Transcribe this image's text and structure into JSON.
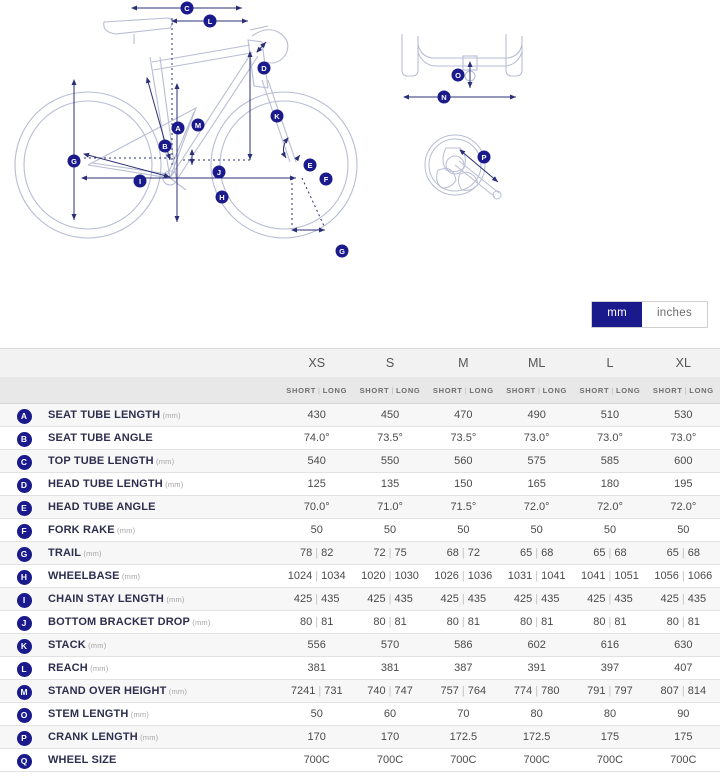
{
  "diagram": {
    "bike_markers": [
      "C",
      "L",
      "D",
      "A",
      "M",
      "B",
      "K",
      "E",
      "F",
      "G",
      "I",
      "H",
      "J",
      "O"
    ],
    "handlebar_markers": [
      "O",
      "N"
    ],
    "crankset_markers": [
      "P"
    ],
    "accent_color": "#1a1a8c",
    "line_color": "#2b2f77",
    "outline_color": "#b8bdd4"
  },
  "units": {
    "mm_label": "mm",
    "inches_label": "inches",
    "selected": "mm"
  },
  "table": {
    "sizes": [
      "XS",
      "S",
      "M",
      "ML",
      "L",
      "XL"
    ],
    "sub_headers": {
      "short": "SHORT",
      "long": "LONG",
      "separator": "|"
    },
    "rows": [
      {
        "badge": "A",
        "label": "SEAT TUBE LENGTH",
        "unit": "(mm)",
        "values": [
          "430",
          "450",
          "470",
          "490",
          "510",
          "530"
        ]
      },
      {
        "badge": "B",
        "label": "SEAT TUBE ANGLE",
        "unit": "",
        "values": [
          "74.0°",
          "73.5°",
          "73.5°",
          "73.0°",
          "73.0°",
          "73.0°"
        ]
      },
      {
        "badge": "C",
        "label": "TOP TUBE LENGTH",
        "unit": "(mm)",
        "values": [
          "540",
          "550",
          "560",
          "575",
          "585",
          "600"
        ]
      },
      {
        "badge": "D",
        "label": "HEAD TUBE LENGTH",
        "unit": "(mm)",
        "values": [
          "125",
          "135",
          "150",
          "165",
          "180",
          "195"
        ]
      },
      {
        "badge": "E",
        "label": "HEAD TUBE ANGLE",
        "unit": "",
        "values": [
          "70.0°",
          "71.0°",
          "71.5°",
          "72.0°",
          "72.0°",
          "72.0°"
        ]
      },
      {
        "badge": "F",
        "label": "FORK RAKE",
        "unit": "(mm)",
        "values": [
          "50",
          "50",
          "50",
          "50",
          "50",
          "50"
        ]
      },
      {
        "badge": "G",
        "label": "TRAIL",
        "unit": "(mm)",
        "pairs": [
          [
            "78",
            "82"
          ],
          [
            "72",
            "75"
          ],
          [
            "68",
            "72"
          ],
          [
            "65",
            "68"
          ],
          [
            "65",
            "68"
          ],
          [
            "65",
            "68"
          ]
        ]
      },
      {
        "badge": "H",
        "label": "WHEELBASE",
        "unit": "(mm)",
        "pairs": [
          [
            "1024",
            "1034"
          ],
          [
            "1020",
            "1030"
          ],
          [
            "1026",
            "1036"
          ],
          [
            "1031",
            "1041"
          ],
          [
            "1041",
            "1051"
          ],
          [
            "1056",
            "1066"
          ]
        ]
      },
      {
        "badge": "I",
        "label": "CHAIN STAY LENGTH",
        "unit": "(mm)",
        "pairs": [
          [
            "425",
            "435"
          ],
          [
            "425",
            "435"
          ],
          [
            "425",
            "435"
          ],
          [
            "425",
            "435"
          ],
          [
            "425",
            "435"
          ],
          [
            "425",
            "435"
          ]
        ]
      },
      {
        "badge": "J",
        "label": "BOTTOM BRACKET DROP",
        "unit": "(mm)",
        "pairs": [
          [
            "80",
            "81"
          ],
          [
            "80",
            "81"
          ],
          [
            "80",
            "81"
          ],
          [
            "80",
            "81"
          ],
          [
            "80",
            "81"
          ],
          [
            "80",
            "81"
          ]
        ]
      },
      {
        "badge": "K",
        "label": "STACK",
        "unit": "(mm)",
        "values": [
          "556",
          "570",
          "586",
          "602",
          "616",
          "630"
        ]
      },
      {
        "badge": "L",
        "label": "REACH",
        "unit": "(mm)",
        "values": [
          "381",
          "381",
          "387",
          "391",
          "397",
          "407"
        ]
      },
      {
        "badge": "M",
        "label": "STAND OVER HEIGHT",
        "unit": "(mm)",
        "pairs": [
          [
            "7241",
            "731"
          ],
          [
            "740",
            "747"
          ],
          [
            "757",
            "764"
          ],
          [
            "774",
            "780"
          ],
          [
            "791",
            "797"
          ],
          [
            "807",
            "814"
          ]
        ]
      },
      {
        "badge": "O",
        "label": "STEM LENGTH",
        "unit": "(mm)",
        "values": [
          "50",
          "60",
          "70",
          "80",
          "80",
          "90"
        ]
      },
      {
        "badge": "P",
        "label": "CRANK LENGTH",
        "unit": "(mm)",
        "values": [
          "170",
          "170",
          "172.5",
          "172.5",
          "175",
          "175"
        ]
      },
      {
        "badge": "Q",
        "label": "WHEEL SIZE",
        "unit": "",
        "values": [
          "700C",
          "700C",
          "700C",
          "700C",
          "700C",
          "700C"
        ]
      }
    ]
  }
}
